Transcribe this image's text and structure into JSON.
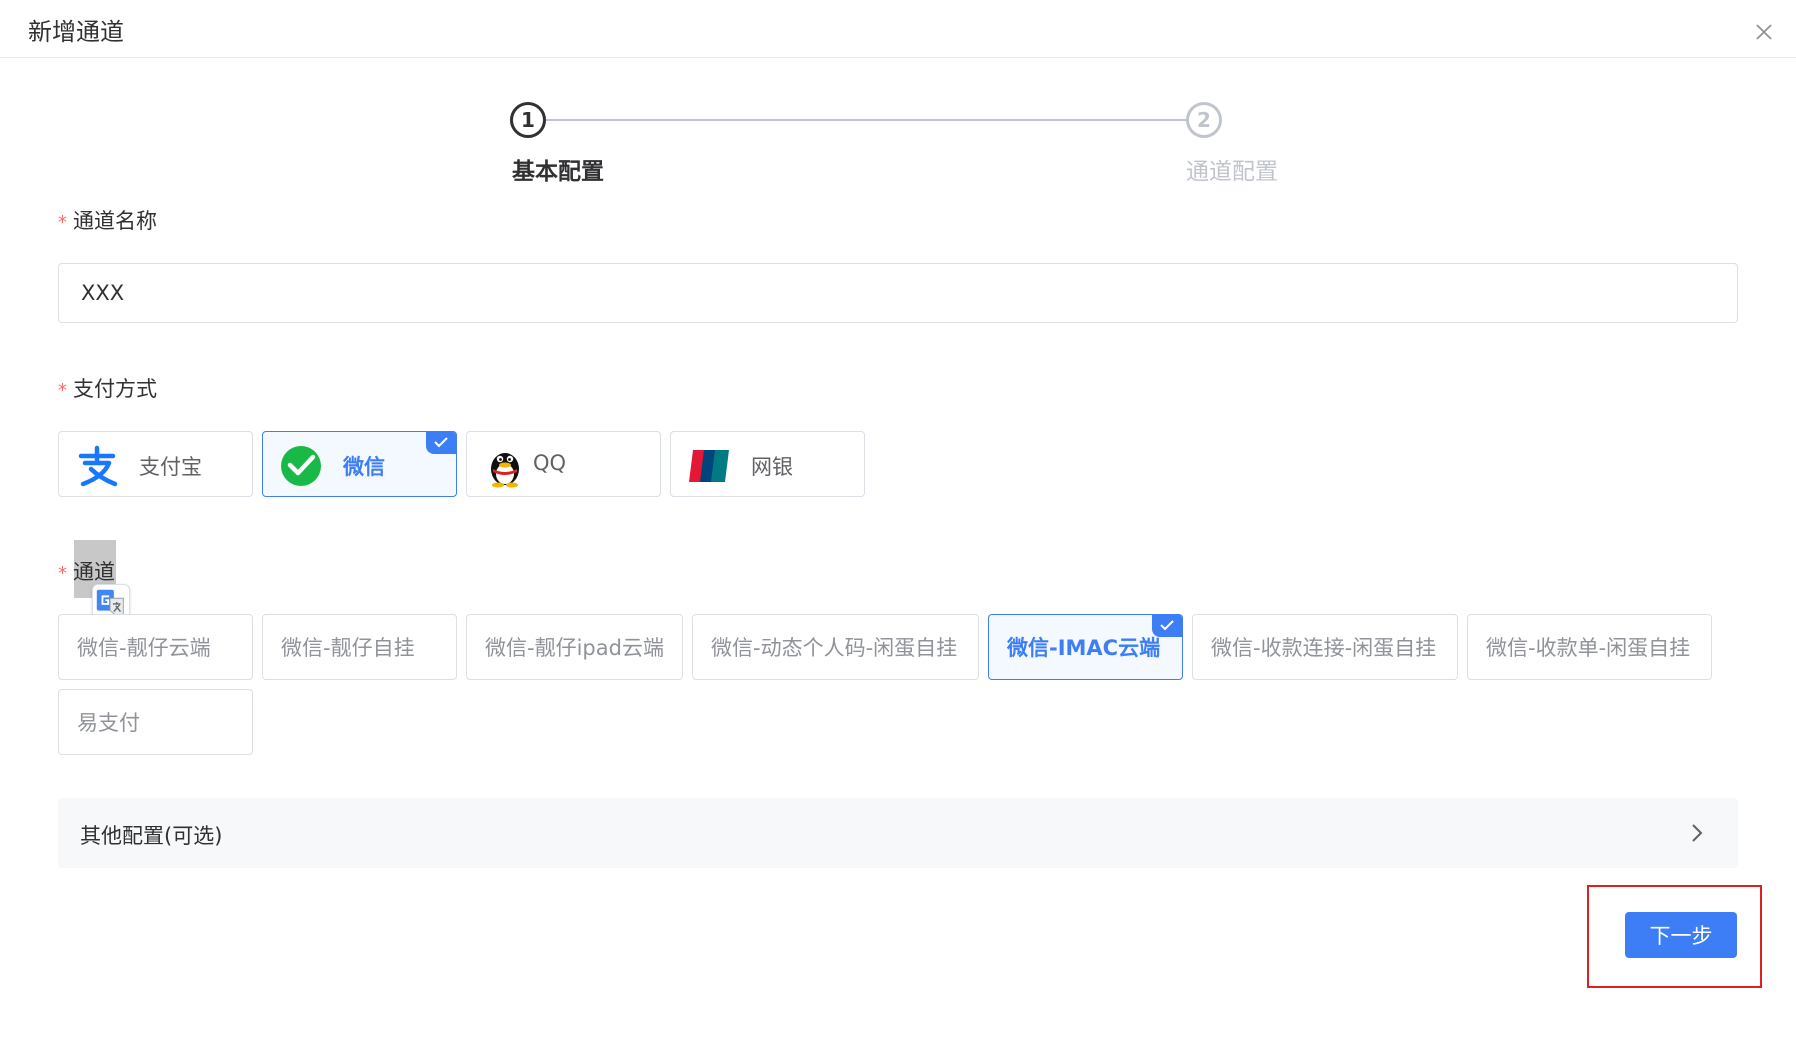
{
  "dialog": {
    "title": "新增通道"
  },
  "steps": [
    {
      "number": "1",
      "label": "基本配置",
      "state": "active"
    },
    {
      "number": "2",
      "label": "通道配置",
      "state": "pending"
    }
  ],
  "form": {
    "required_mark": "*",
    "channel_name": {
      "label": "通道名称",
      "value": "XXX"
    },
    "payment_method": {
      "label": "支付方式",
      "options": [
        {
          "label": "支付宝",
          "icon": "alipay-icon",
          "selected": false
        },
        {
          "label": "微信",
          "icon": "wechat-icon",
          "selected": true
        },
        {
          "label": "QQ",
          "icon": "qq-icon",
          "selected": false
        },
        {
          "label": "网银",
          "icon": "unionpay-icon",
          "selected": false
        }
      ]
    },
    "channel": {
      "label": "通道",
      "options": [
        {
          "label": "微信-靓仔云端",
          "selected": false
        },
        {
          "label": "微信-靓仔自挂",
          "selected": false
        },
        {
          "label": "微信-靓仔ipad云端",
          "selected": false
        },
        {
          "label": "微信-动态个人码-闲蛋自挂",
          "selected": false
        },
        {
          "label": "微信-IMAC云端",
          "selected": true
        },
        {
          "label": "微信-收款连接-闲蛋自挂",
          "selected": false
        },
        {
          "label": "微信-收款单-闲蛋自挂",
          "selected": false
        },
        {
          "label": "易支付",
          "selected": false
        }
      ]
    },
    "other_config": {
      "label": "其他配置(可选)"
    }
  },
  "footer": {
    "next_label": "下一步"
  },
  "colors": {
    "accent": "#3d7ef7",
    "required": "#f56c6c",
    "highlight": "#e02020"
  }
}
